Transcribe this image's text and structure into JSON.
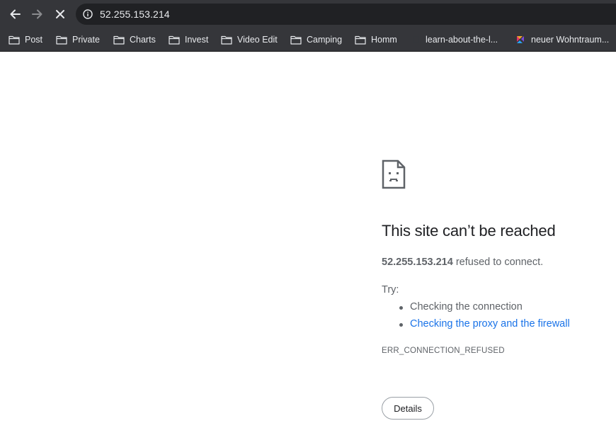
{
  "toolbar": {
    "url": "52.255.153.214"
  },
  "bookmarks": [
    {
      "label": "Post",
      "icon": "folder-icon"
    },
    {
      "label": "Private",
      "icon": "folder-icon"
    },
    {
      "label": "Charts",
      "icon": "folder-icon"
    },
    {
      "label": "Invest",
      "icon": "folder-icon"
    },
    {
      "label": "Video Edit",
      "icon": "folder-icon"
    },
    {
      "label": "Camping",
      "icon": "folder-icon"
    },
    {
      "label": "Homm",
      "icon": "folder-icon"
    },
    {
      "label": "learn-about-the-l...",
      "icon": "page-icon"
    },
    {
      "label": "neuer Wohntraum...",
      "icon": "site-favicon"
    }
  ],
  "error": {
    "title": "This site can’t be reached",
    "host": "52.255.153.214",
    "message_suffix": "refused to connect.",
    "try_label": "Try:",
    "suggestions": [
      "Checking the connection",
      "Checking the proxy and the firewall"
    ],
    "code": "ERR_CONNECTION_REFUSED",
    "details_label": "Details"
  },
  "colors": {
    "toolbar_bg": "#35363a",
    "omnibox_bg": "#202124",
    "link": "#1a73e8",
    "text_secondary": "#5f6368",
    "title": "#202124"
  }
}
